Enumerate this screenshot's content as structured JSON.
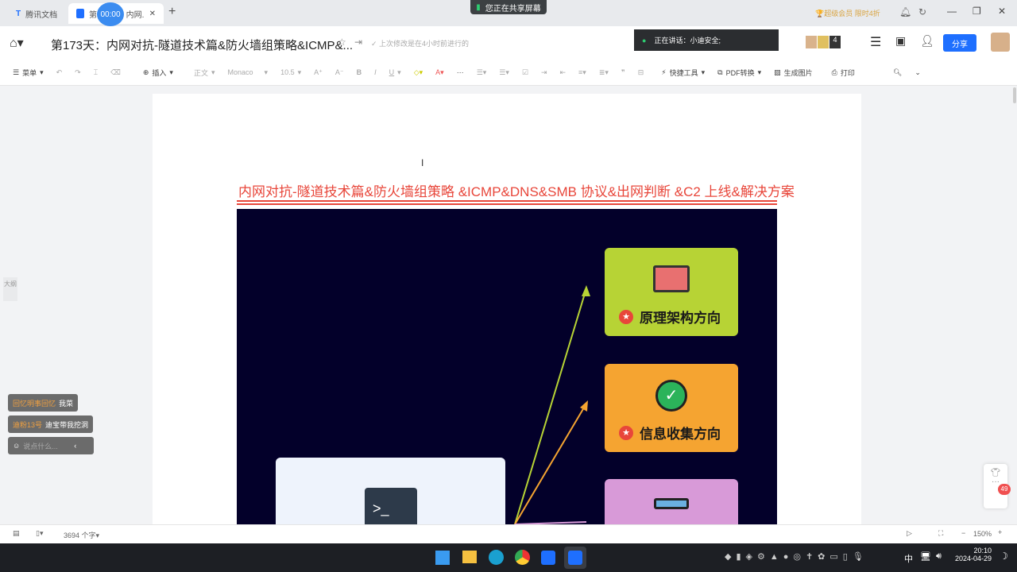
{
  "tabs": [
    {
      "label": "腾讯文档"
    },
    {
      "label": "第173天：内网..."
    }
  ],
  "timer": "00:00",
  "screen_share": "您正在共享屏幕",
  "vip": "超级会员 限时4折",
  "doc_title": "第173天：内网对抗-隧道技术篇&防火墙组策略&ICMP&...",
  "last_edit": "上次修改是在4小时前进行的",
  "speaking": "正在讲话：小迪安全;",
  "collab_count": "4",
  "share_button": "分享",
  "toolbar": {
    "menu": "菜单",
    "insert": "插入",
    "style": "正文",
    "font": "Monaco",
    "size": "10.5",
    "quick_tools": "快捷工具",
    "pdf": "PDF转换",
    "gen_image": "生成图片",
    "print": "打印"
  },
  "outline_tab": "大纲",
  "content": {
    "heading": "内网对抗-隧道技术篇&防火墙组策略 &ICMP&DNS&SMB 协议&出网判断 &C2 上线&解决方案",
    "boxes": [
      {
        "label": "原理架构方向",
        "color": "#b7d335"
      },
      {
        "label": "信息收集方向",
        "color": "#f5a431"
      },
      {
        "label": "",
        "color": "#d89ad8"
      }
    ]
  },
  "chat": [
    {
      "name": "回忆明事回忆",
      "text": "我菜"
    },
    {
      "name": "迪粉13号",
      "text": "迪宝带我挖洞"
    }
  ],
  "chat_placeholder": "说点什么...",
  "notif_badge": "49",
  "status": {
    "word_count": "3694 个字",
    "zoom": "150%"
  },
  "taskbar": {
    "time": "20:10",
    "date": "2024-04-29",
    "ime": "中"
  }
}
